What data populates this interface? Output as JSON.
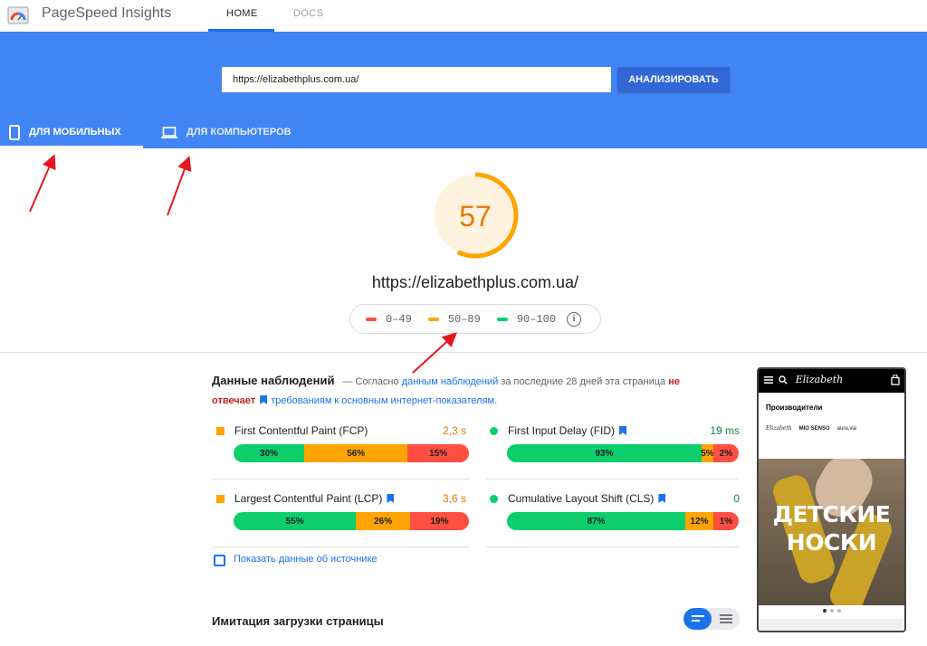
{
  "app": {
    "title": "PageSpeed Insights",
    "nav": {
      "home": "HOME",
      "docs": "DOCS"
    }
  },
  "search": {
    "url_value": "https://elizabethplus.com.ua/",
    "button_label": "АНАЛИЗИРОВАТЬ"
  },
  "device_tabs": {
    "mobile": "ДЛЯ МОБИЛЬНЫХ",
    "desktop": "ДЛЯ КОМПЬЮТЕРОВ"
  },
  "result": {
    "score": "57",
    "score_fraction": 0.57,
    "url": "https://elizabethplus.com.ua/",
    "legend": [
      {
        "label": "0–49",
        "color": "#ff4e42"
      },
      {
        "label": "50–89",
        "color": "#ffa400"
      },
      {
        "label": "90–100",
        "color": "#0cce6b"
      }
    ]
  },
  "field_data": {
    "title": "Данные наблюдений",
    "text_before": "— Согласно",
    "link": "данным наблюдений",
    "text_middle": "за последние 28 дней эта страница",
    "fail": "не отвечает",
    "requirement": "требованиям к основным интернет-показателям."
  },
  "metrics": [
    {
      "name": "First Contentful Paint (FCP)",
      "value": "2,3 s",
      "value_color": "#e67700",
      "indicator": "square",
      "bookmark": false,
      "dist": [
        "30%",
        "56%",
        "15%"
      ]
    },
    {
      "name": "First Input Delay (FID)",
      "value": "19 ms",
      "value_color": "#0a8a47",
      "indicator": "circle",
      "bookmark": true,
      "dist": [
        "93%",
        "5%",
        "2%"
      ]
    },
    {
      "name": "Largest Contentful Paint (LCP)",
      "value": "3,6 s",
      "value_color": "#e67700",
      "indicator": "square",
      "bookmark": true,
      "dist": [
        "55%",
        "26%",
        "19%"
      ]
    },
    {
      "name": "Cumulative Layout Shift (CLS)",
      "value": "0",
      "value_color": "#0a8a47",
      "indicator": "circle",
      "bookmark": true,
      "dist": [
        "87%",
        "12%",
        "1%"
      ]
    }
  ],
  "origin_label": "Показать данные об источнике",
  "lab_title": "Имитация загрузки страницы",
  "phone": {
    "brand": "Elizabeth",
    "section": "Производители",
    "brands": [
      "Elizabeth",
      "MIO SENSO",
      "aura.via"
    ],
    "promo_line1": "ДЕТСКИЕ",
    "promo_line2": "НОСКИ"
  },
  "colors": {
    "accent": "#4285f4",
    "good": "#0cce6b",
    "average": "#ffa400",
    "poor": "#ff4e42"
  }
}
